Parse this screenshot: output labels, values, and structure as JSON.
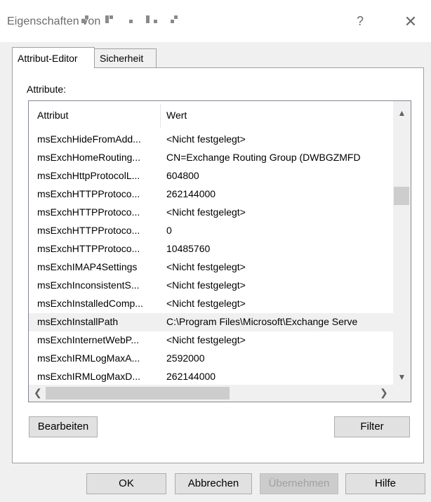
{
  "window": {
    "title": "Eigenschaften von",
    "help_glyph": "?",
    "close_glyph": "✕"
  },
  "tabs": [
    {
      "label": "Attribut-Editor",
      "active": true
    },
    {
      "label": "Sicherheit",
      "active": false
    }
  ],
  "panel": {
    "attributes_label": "Attribute:",
    "columns": {
      "attr": "Attribut",
      "value": "Wert"
    },
    "rows": [
      {
        "attr": "msExchHideFromAdd...",
        "value": "<Nicht festgelegt>"
      },
      {
        "attr": "msExchHomeRouting...",
        "value": "CN=Exchange Routing Group (DWBGZMFD"
      },
      {
        "attr": "msExchHttpProtocolL...",
        "value": "604800"
      },
      {
        "attr": "msExchHTTPProtoco...",
        "value": "262144000"
      },
      {
        "attr": "msExchHTTPProtoco...",
        "value": "<Nicht festgelegt>"
      },
      {
        "attr": "msExchHTTPProtoco...",
        "value": "0"
      },
      {
        "attr": "msExchHTTPProtoco...",
        "value": "10485760"
      },
      {
        "attr": "msExchIMAP4Settings",
        "value": "<Nicht festgelegt>"
      },
      {
        "attr": "msExchInconsistentS...",
        "value": "<Nicht festgelegt>"
      },
      {
        "attr": "msExchInstalledComp...",
        "value": "<Nicht festgelegt>"
      },
      {
        "attr": "msExchInstallPath",
        "value": "C:\\Program Files\\Microsoft\\Exchange Serve",
        "selected": true
      },
      {
        "attr": "msExchInternetWebP...",
        "value": "<Nicht festgelegt>"
      },
      {
        "attr": "msExchIRMLogMaxA...",
        "value": "2592000"
      },
      {
        "attr": "msExchIRMLogMaxD...",
        "value": "262144000"
      }
    ],
    "edit_button": "Bearbeiten",
    "filter_button": "Filter"
  },
  "footer": {
    "ok": "OK",
    "cancel": "Abbrechen",
    "apply": "Übernehmen",
    "help": "Hilfe"
  },
  "icons": {
    "scroll_up": "up-arrow-icon",
    "scroll_down": "down-arrow-icon",
    "scroll_left": "left-arrow-icon",
    "scroll_right": "right-arrow-icon"
  }
}
